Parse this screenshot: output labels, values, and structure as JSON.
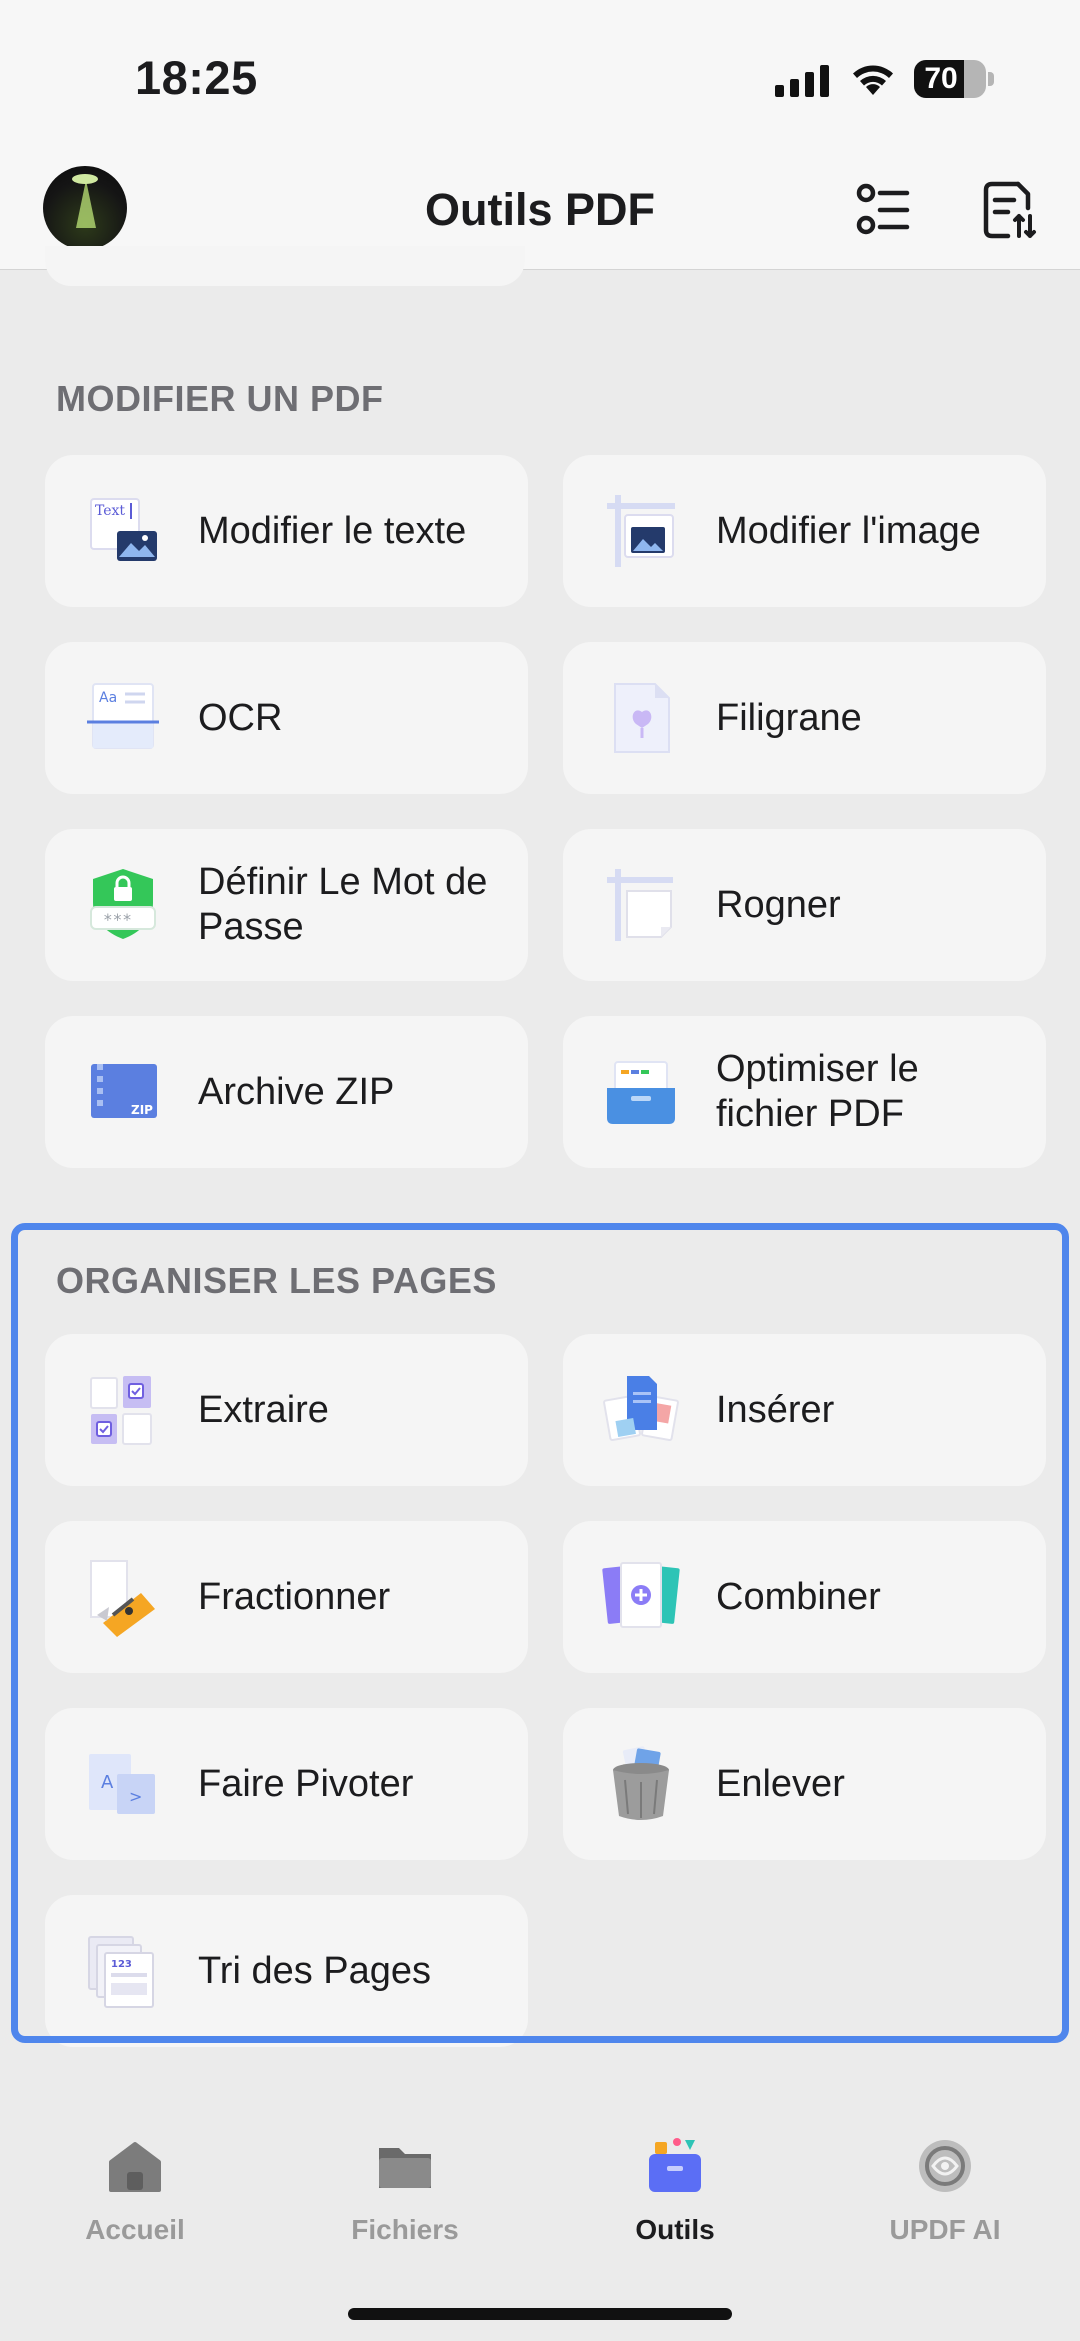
{
  "status_bar": {
    "time": "18:25",
    "battery": "70"
  },
  "header": {
    "title": "Outils PDF"
  },
  "sections": {
    "modify": {
      "title": "MODIFIER UN PDF",
      "tools": {
        "edit_text": "Modifier le texte",
        "edit_image": "Modifier l'image",
        "ocr": "OCR",
        "watermark": "Filigrane",
        "password": "Définir Le Mot de Passe",
        "crop": "Rogner",
        "zip": "Archive ZIP",
        "optimize": "Optimiser le fichier PDF"
      }
    },
    "organize": {
      "title": "ORGANISER LES PAGES",
      "tools": {
        "extract": "Extraire",
        "insert": "Insérer",
        "split": "Fractionner",
        "combine": "Combiner",
        "rotate": "Faire Pivoter",
        "remove": "Enlever",
        "sort": "Tri des Pages"
      }
    }
  },
  "tab_bar": {
    "home": "Accueil",
    "files": "Fichiers",
    "tools": "Outils",
    "ai": "UPDF AI"
  },
  "colors": {
    "highlight": "#4f86ec",
    "accent_purple": "#8b7cf6",
    "accent_green": "#34c759"
  }
}
